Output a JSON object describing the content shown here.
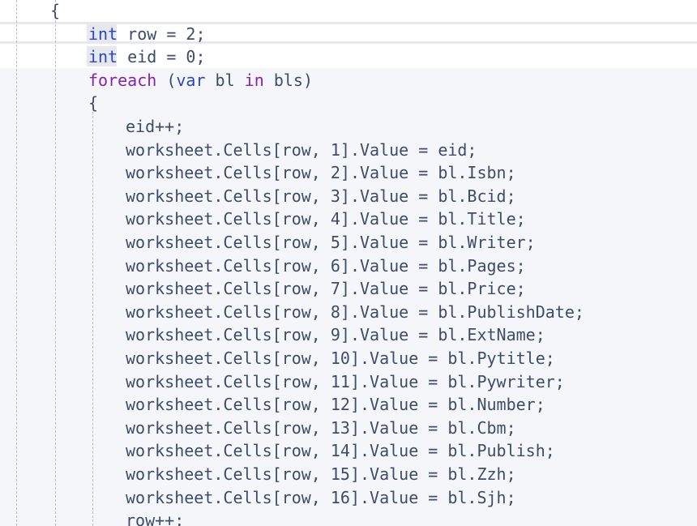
{
  "editor": {
    "colors": {
      "background": "#f5f6f9",
      "text": "#3b4d6b",
      "keyword_type": "#2a46c8",
      "keyword_control": "#8a1fb0",
      "current_line_band": "#ffffff"
    },
    "lines": [
      {
        "indent": 1,
        "tokens": [
          {
            "text": "{",
            "type": "plain"
          }
        ]
      },
      {
        "indent": 2,
        "tokens": [
          {
            "text": "int",
            "type": "kw"
          },
          {
            "text": " row = 2;",
            "type": "plain"
          }
        ]
      },
      {
        "indent": 2,
        "tokens": [
          {
            "text": "int",
            "type": "kw"
          },
          {
            "text": " eid = 0;",
            "type": "plain"
          }
        ]
      },
      {
        "indent": 2,
        "tokens": [
          {
            "text": "foreach",
            "type": "kw2"
          },
          {
            "text": " (",
            "type": "plain"
          },
          {
            "text": "var",
            "type": "kw"
          },
          {
            "text": " bl ",
            "type": "plain"
          },
          {
            "text": "in",
            "type": "kw2"
          },
          {
            "text": " bls)",
            "type": "plain"
          }
        ]
      },
      {
        "indent": 2,
        "tokens": [
          {
            "text": "{",
            "type": "plain"
          }
        ]
      },
      {
        "indent": 3,
        "tokens": [
          {
            "text": "eid++;",
            "type": "plain"
          }
        ]
      },
      {
        "indent": 3,
        "tokens": [
          {
            "text": "worksheet.Cells[row, 1].Value = eid;",
            "type": "plain"
          }
        ]
      },
      {
        "indent": 3,
        "tokens": [
          {
            "text": "worksheet.Cells[row, 2].Value = bl.Isbn;",
            "type": "plain"
          }
        ]
      },
      {
        "indent": 3,
        "tokens": [
          {
            "text": "worksheet.Cells[row, 3].Value = bl.Bcid;",
            "type": "plain"
          }
        ]
      },
      {
        "indent": 3,
        "tokens": [
          {
            "text": "worksheet.Cells[row, 4].Value = bl.Title;",
            "type": "plain"
          }
        ]
      },
      {
        "indent": 3,
        "tokens": [
          {
            "text": "worksheet.Cells[row, 5].Value = bl.Writer;",
            "type": "plain"
          }
        ]
      },
      {
        "indent": 3,
        "tokens": [
          {
            "text": "worksheet.Cells[row, 6].Value = bl.Pages;",
            "type": "plain"
          }
        ]
      },
      {
        "indent": 3,
        "tokens": [
          {
            "text": "worksheet.Cells[row, 7].Value = bl.Price;",
            "type": "plain"
          }
        ]
      },
      {
        "indent": 3,
        "tokens": [
          {
            "text": "worksheet.Cells[row, 8].Value = bl.PublishDate;",
            "type": "plain"
          }
        ]
      },
      {
        "indent": 3,
        "tokens": [
          {
            "text": "worksheet.Cells[row, 9].Value = bl.ExtName;",
            "type": "plain"
          }
        ]
      },
      {
        "indent": 3,
        "tokens": [
          {
            "text": "worksheet.Cells[row, 10].Value = bl.Pytitle;",
            "type": "plain"
          }
        ]
      },
      {
        "indent": 3,
        "tokens": [
          {
            "text": "worksheet.Cells[row, 11].Value = bl.Pywriter;",
            "type": "plain"
          }
        ]
      },
      {
        "indent": 3,
        "tokens": [
          {
            "text": "worksheet.Cells[row, 12].Value = bl.Number;",
            "type": "plain"
          }
        ]
      },
      {
        "indent": 3,
        "tokens": [
          {
            "text": "worksheet.Cells[row, 13].Value = bl.Cbm;",
            "type": "plain"
          }
        ]
      },
      {
        "indent": 3,
        "tokens": [
          {
            "text": "worksheet.Cells[row, 14].Value = bl.Publish;",
            "type": "plain"
          }
        ]
      },
      {
        "indent": 3,
        "tokens": [
          {
            "text": "worksheet.Cells[row, 15].Value = bl.Zzh;",
            "type": "plain"
          }
        ]
      },
      {
        "indent": 3,
        "tokens": [
          {
            "text": "worksheet.Cells[row, 16].Value = bl.Sjh;",
            "type": "plain"
          }
        ]
      },
      {
        "indent": 3,
        "tokens": [
          {
            "text": "row++;",
            "type": "plain"
          }
        ]
      }
    ]
  }
}
